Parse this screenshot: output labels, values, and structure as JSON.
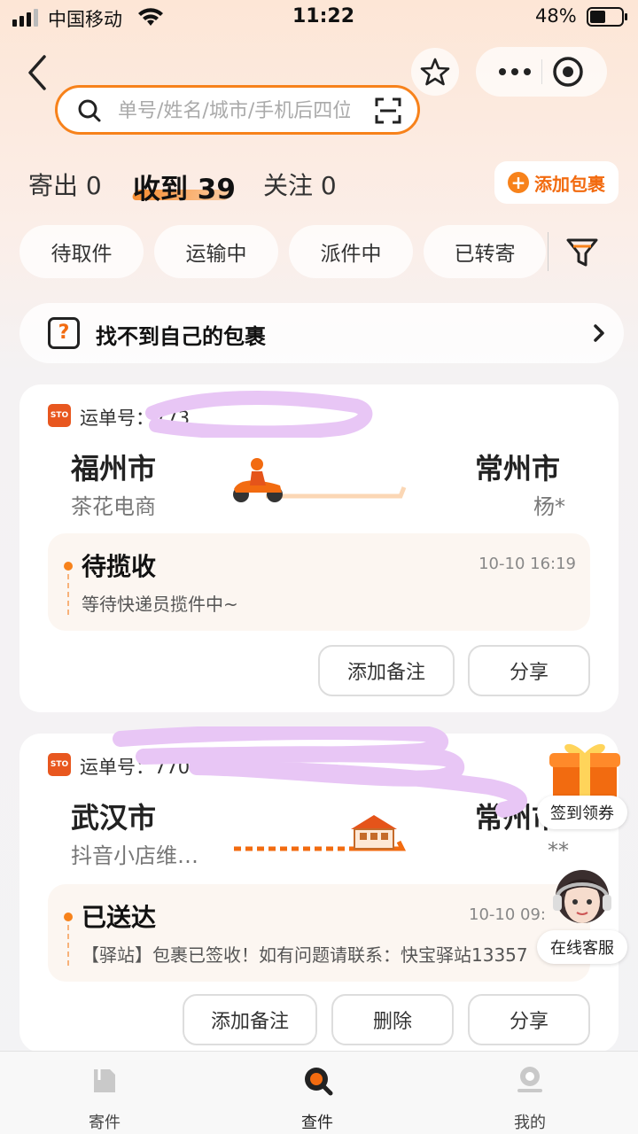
{
  "status_bar": {
    "carrier": "中国移动",
    "time": "11:22",
    "battery": "48%"
  },
  "search": {
    "placeholder": "单号/姓名/城市/手机后四位"
  },
  "tabs": {
    "sent": "寄出 0",
    "received": "收到 39",
    "following": "关注 0"
  },
  "add_package": "添加包裹",
  "filters": [
    "待取件",
    "运输中",
    "派件中",
    "已转寄"
  ],
  "find_banner": {
    "icon_text": "?",
    "text": "找不到自己的包裹"
  },
  "packages": [
    {
      "carrier_logo": "STO",
      "waybill": "运单号：773",
      "from_city": "福州市",
      "from_name": "茶花电商",
      "to_city": "常州市",
      "to_name": "杨*",
      "status": "待揽收",
      "time": "10-10 16:19",
      "desc": "等待快递员揽件中~",
      "buttons": [
        "添加备注",
        "分享"
      ]
    },
    {
      "carrier_logo": "STO",
      "waybill": "运单号：7700701",
      "from_city": "武汉市",
      "from_name": "抖音小店维…",
      "to_city": "常州市",
      "to_name": "**",
      "status": "已送达",
      "time": "10-10 09:",
      "desc": "【驿站】包裹已签收！如有问题请联系：快宝驿站13357",
      "buttons": [
        "添加备注",
        "删除",
        "分享"
      ]
    }
  ],
  "floaters": {
    "gift_label": "签到领券",
    "cs_label": "在线客服"
  },
  "tabbar": {
    "items": [
      "寄件",
      "查件",
      "我的"
    ]
  },
  "colors": {
    "accent": "#f7821b",
    "brand_sto": "#e8571f",
    "scribble": "#e8c6f5"
  }
}
